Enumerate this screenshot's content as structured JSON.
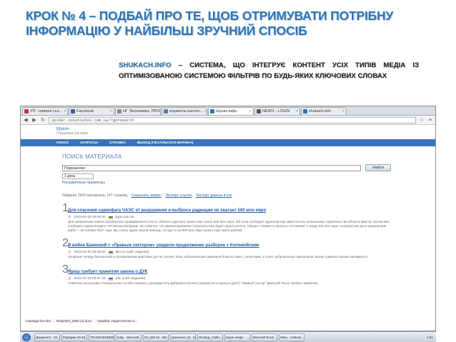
{
  "slide": {
    "title_line1": "КРОК № 4 –  ПОДБАЙ ПРО ТЕ, ЩОБ ОТРИМУВАТИ ПОТРІБНУ",
    "title_line2": "ІНФОРМАЦІЮ У НАЙБІЛЬШ ЗРУЧНИЙ СПОСІБ",
    "brand": "SHUKACH.INFO",
    "subtitle_rest": " – СИСТЕМА, ЩО ІНТЕГРУЄ КОНТЕНТ УСІХ ТИПІВ МЕДІА ІЗ ОПТИМІЗОВАНОЮ СИСТЕМОЮ ФІЛЬТРІВ ПО БУДЬ-ЯКИХ КЛЮЧОВИХ СЛОВАХ"
  },
  "browser": {
    "tabs": [
      {
        "label": "УП - новини сьо...",
        "color": "#c0392b",
        "active": false
      },
      {
        "label": "Facebook",
        "color": "#3b5998",
        "active": false
      },
      {
        "label": "НГ Экономика, ПРОСК...",
        "color": "#888888",
        "active": false
      },
      {
        "label": "корзинты кантон...",
        "color": "#4a7ebb",
        "active": false
      },
      {
        "label": "Шукач.інфо",
        "color": "#2e75b6",
        "active": true
      },
      {
        "label": "NEWS - LOGIN",
        "color": "#555555",
        "active": false
      },
      {
        "label": "shukach.info",
        "color": "#2e75b6",
        "active": false
      }
    ],
    "url": "spider.nokshishes.com.ua/?go=search",
    "site_name": "Шукач",
    "site_tagline": "Пошукова система",
    "nav": [
      "ПОИСК",
      "ЗАПРОСЫ",
      "СПРАВКА",
      "ВЫХОД (ПЕХАЛЬСКАЯ МАРИНА)"
    ]
  },
  "search": {
    "section_title": "ПОИСК МАТЕРИАЛА",
    "query": "Порошенко",
    "button": "Найти",
    "period": "1 день",
    "extended": "Расширенные параметры",
    "found": "Найдено 2923 материала, 147 страниц.",
    "links": [
      "Сохранить запрос",
      "Экспорт ссылок",
      "Экспорт данных в csv"
    ]
  },
  "results": [
    {
      "num": "1",
      "title": "Для спасения саркофага ЧАЭС от разрушения и выброса радиации не хватает 500 млн евро",
      "meta": "2015-04-30 06:58:40",
      "source": "Ера.com.ua",
      "text": "Для завершения нового безопасного конфайнмента (часть объекта укрытие) нужно еще около 500 млн евро. Об этом сообщает журналистам заместитель начальника строительства объекта Виктор Залевский, сообщает корреспондент ЛІГАБизнесИнформ. Он отметил, что финансирования строительства будет недостаточно. Общая стоимость проекта составляет 1 млрд 426 млн евро, контрактная дата завершения работ – 30 ноября 2017 года. Мы очень ждем нашей помощь, но где-то на 500 млн евро нужно еще найти рублей."
    },
    {
      "num": "2",
      "title": "В войне Банковой с «Правым сектором» увидели продолжение разборок с Коломойским",
      "meta": "2015-04-30 06:58:00",
      "source": "Вести (сайт издания)",
      "text": "Конфликт между батальоном и разорванным войсками достиг апогея. Базу добровольцев окружили блокпостами с зенитками, в ответ добровольцы пригрозили силам Администрации президента"
    },
    {
      "num": "3",
      "title": "Ярош требует принятия закона о ДУК",
      "meta": "2015-04-30 06:57:44",
      "source": "рбк (сайт издания)",
      "text": "Советник начальника Генерального штаба Украины, руководитель Добровольческого украинского корпуса (ДУК) \"Правый сектор\" Дмитрий Ярош требует принятия"
    }
  ],
  "downloads": [
    "massage box.xbv",
    "DailyAlert_2904 (2).docx",
    "Ошибка: Недостаточно н..."
  ],
  "taskbar": {
    "items": [
      "Документ2 - Mi...",
      "Реформи 29-29...",
      "TRANSCENDMZ ...",
      "2day - Microsoft...",
      "KS_Mar'15 - Mic...",
      "прочитать (4) - Mic...",
      "Strategy_Outlin...",
      "Шукач.инфо - ...",
      "Microsoft Excel...",
      "Inbox - Outlook..."
    ],
    "time": "1:41"
  }
}
